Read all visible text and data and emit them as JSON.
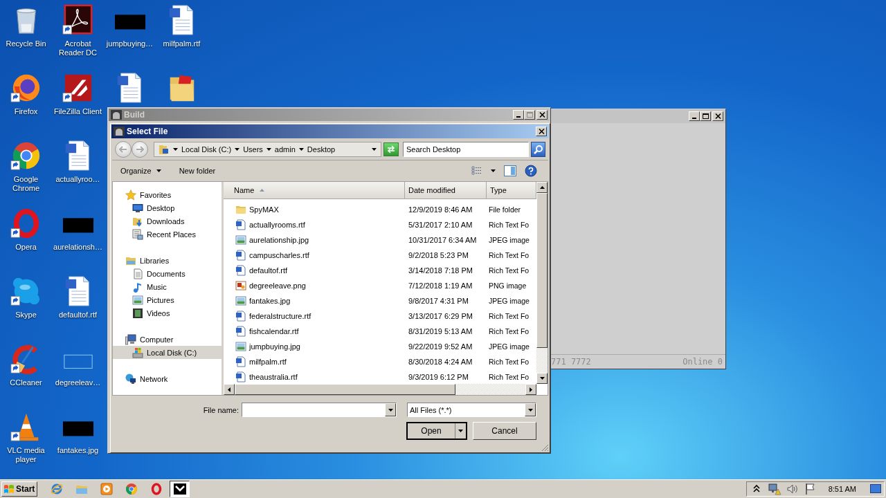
{
  "desktop": {
    "columns": [
      [
        {
          "label": "Recycle Bin",
          "kind": "recycle-bin",
          "shortcut": false
        },
        {
          "label": "Firefox",
          "kind": "firefox",
          "shortcut": true
        },
        {
          "label": "Google Chrome",
          "kind": "chrome",
          "shortcut": true
        },
        {
          "label": "Opera",
          "kind": "opera",
          "shortcut": true
        },
        {
          "label": "Skype",
          "kind": "skype",
          "shortcut": true
        },
        {
          "label": "CCleaner",
          "kind": "ccleaner",
          "shortcut": true
        },
        {
          "label": "VLC media player",
          "kind": "vlc",
          "shortcut": true
        }
      ],
      [
        {
          "label": "Acrobat Reader DC",
          "kind": "acrobat",
          "shortcut": true
        },
        {
          "label": "FileZilla Client",
          "kind": "filezilla",
          "shortcut": true
        },
        {
          "label": "actuallyroo…",
          "kind": "word-doc",
          "shortcut": false
        },
        {
          "label": "aurelationsh…",
          "kind": "black-thumb",
          "shortcut": false
        },
        {
          "label": "defaultof.rtf",
          "kind": "word-doc",
          "shortcut": false
        },
        {
          "label": "degreeleav…",
          "kind": "blank-thumb",
          "shortcut": false
        },
        {
          "label": "fantakes.jpg",
          "kind": "black-thumb",
          "shortcut": false
        }
      ],
      [
        {
          "label": "jumpbuying…",
          "kind": "black-thumb",
          "shortcut": false
        },
        {
          "kind": "word-doc",
          "shortcut": false
        }
      ],
      [
        {
          "label": "milfpalm.rtf",
          "kind": "word-doc",
          "shortcut": false
        },
        {
          "kind": "pdf-folder",
          "shortcut": false
        }
      ]
    ]
  },
  "background_window": {
    "buttons": [
      {
        "kind": "minimize",
        "disabled": false
      },
      {
        "kind": "maximize",
        "disabled": false
      },
      {
        "kind": "close",
        "disabled": false
      }
    ],
    "status_bar": [
      "771 7772",
      "Online 0"
    ]
  },
  "build_window": {
    "title": "Build",
    "buttons": [
      {
        "kind": "minimize",
        "disabled": false
      },
      {
        "kind": "maximize",
        "disabled": true
      },
      {
        "kind": "close",
        "disabled": false
      }
    ]
  },
  "dialog": {
    "title": "Select File",
    "breadcrumb": [
      "Local Disk (C:)",
      "Users",
      "admin",
      "Desktop"
    ],
    "search": {
      "placeholder": "Search Desktop"
    },
    "toolbar": [
      {
        "label": "Organize",
        "dropdown": true
      },
      {
        "label": "New folder",
        "dropdown": false
      }
    ],
    "navigation": [
      {
        "label": "Favorites",
        "kind": "star",
        "selected": false,
        "children": [
          {
            "label": "Desktop",
            "kind": "desktop",
            "selected": false
          },
          {
            "label": "Downloads",
            "kind": "downloads",
            "selected": false
          },
          {
            "label": "Recent Places",
            "kind": "recent",
            "selected": false
          }
        ]
      },
      {
        "label": "Libraries",
        "kind": "libraries",
        "selected": false,
        "children": [
          {
            "label": "Documents",
            "kind": "documents",
            "selected": false
          },
          {
            "label": "Music",
            "kind": "music",
            "selected": false
          },
          {
            "label": "Pictures",
            "kind": "pictures",
            "selected": false
          },
          {
            "label": "Videos",
            "kind": "videos",
            "selected": false
          }
        ]
      },
      {
        "label": "Computer",
        "kind": "computer",
        "selected": false,
        "children": [
          {
            "label": "Local Disk (C:)",
            "kind": "disk",
            "selected": true
          }
        ]
      },
      {
        "label": "Network",
        "kind": "network",
        "selected": false
      }
    ],
    "columns": [
      {
        "label": "Name",
        "sorted": true
      },
      {
        "label": "Date modified",
        "sorted": false
      },
      {
        "label": "Type",
        "sorted": false
      }
    ],
    "files": [
      {
        "name": "SpyMAX",
        "date": "12/9/2019 8:46 AM",
        "type": "File folder",
        "kind": "folder"
      },
      {
        "name": "actuallyrooms.rtf",
        "date": "5/31/2017 2:10 AM",
        "type": "Rich Text Fo",
        "kind": "rtf"
      },
      {
        "name": "aurelationship.jpg",
        "date": "10/31/2017 6:34 AM",
        "type": "JPEG image",
        "kind": "jpg"
      },
      {
        "name": "campuscharles.rtf",
        "date": "9/2/2018 5:23 PM",
        "type": "Rich Text Fo",
        "kind": "rtf"
      },
      {
        "name": "defaultof.rtf",
        "date": "3/14/2018 7:18 PM",
        "type": "Rich Text Fo",
        "kind": "rtf"
      },
      {
        "name": "degreeleave.png",
        "date": "7/12/2018 1:19 AM",
        "type": "PNG image",
        "kind": "png"
      },
      {
        "name": "fantakes.jpg",
        "date": "9/8/2017 4:31 PM",
        "type": "JPEG image",
        "kind": "jpg"
      },
      {
        "name": "federalstructure.rtf",
        "date": "3/13/2017 6:29 PM",
        "type": "Rich Text Fo",
        "kind": "rtf"
      },
      {
        "name": "fishcalendar.rtf",
        "date": "8/31/2019 5:13 AM",
        "type": "Rich Text Fo",
        "kind": "rtf"
      },
      {
        "name": "jumpbuying.jpg",
        "date": "9/22/2019 9:52 AM",
        "type": "JPEG image",
        "kind": "jpg"
      },
      {
        "name": "milfpalm.rtf",
        "date": "8/30/2018 4:24 AM",
        "type": "Rich Text Fo",
        "kind": "rtf"
      },
      {
        "name": "theaustralia.rtf",
        "date": "9/3/2019 6:12 PM",
        "type": "Rich Text Fo",
        "kind": "rtf"
      }
    ],
    "file_name": {
      "label": "File name:"
    },
    "filter": {
      "value": "All Files (*.*)"
    },
    "buttons": [
      {
        "label": "Open",
        "split": true
      },
      {
        "label": "Cancel",
        "split": false
      }
    ]
  },
  "taskbar": {
    "start": "Start",
    "apps": [
      {
        "kind": "ie",
        "active": false
      },
      {
        "kind": "explorer",
        "active": false
      },
      {
        "kind": "media",
        "active": false
      },
      {
        "kind": "chrome",
        "active": false
      },
      {
        "kind": "opera",
        "active": false
      },
      {
        "kind": "app",
        "active": true
      }
    ],
    "tray": [
      {
        "kind": "chevrons"
      },
      {
        "kind": "network"
      },
      {
        "kind": "volume"
      },
      {
        "kind": "flag"
      }
    ],
    "clock": "8:51 AM"
  }
}
